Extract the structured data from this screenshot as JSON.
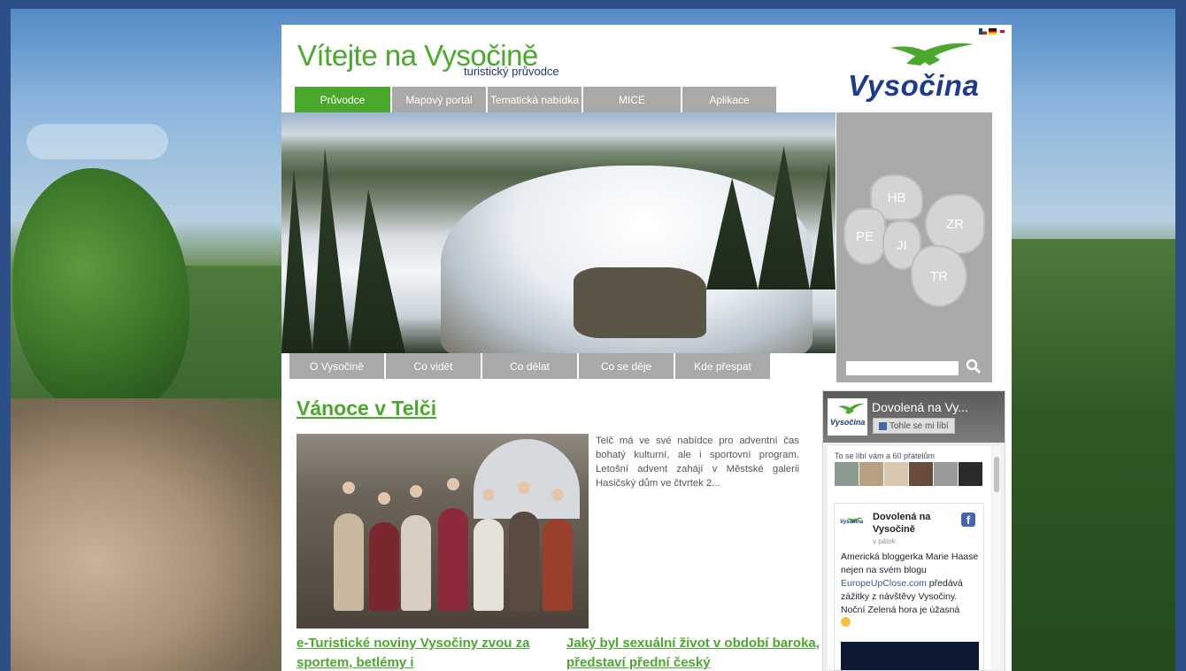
{
  "header": {
    "title": "Vítejte na Vysočině",
    "subtitle": "turistický průvodce",
    "logo_text": "Vysočina"
  },
  "top_nav": [
    {
      "label": "Průvodce"
    },
    {
      "label": "Mapový portál"
    },
    {
      "label": "Tematická nabídka"
    },
    {
      "label": "MICE"
    },
    {
      "label": "Aplikace"
    }
  ],
  "map_regions": {
    "hb": "HB",
    "pe": "PE",
    "ji": "JI",
    "zr": "ZR",
    "tr": "TR"
  },
  "search": {
    "value": "",
    "placeholder": ""
  },
  "sub_nav": [
    {
      "label": "O Vysočině"
    },
    {
      "label": "Co vidět"
    },
    {
      "label": "Co dělat"
    },
    {
      "label": "Co se děje"
    },
    {
      "label": "Kde přespat"
    }
  ],
  "article": {
    "title": "Vánoce v Telči",
    "text": "Telč má ve své nabídce pro adventní čas bohatý kulturní, ale i sportovní program. Letošní advent zahájí v Městské galerii Hasičský dům ve čtvrtek 2..."
  },
  "news": [
    {
      "title": "e-Turistické noviny Vysočiny zvou za sportem, betlémy i"
    },
    {
      "title": "Jaký byl sexuální život v období baroka, představí přední český"
    }
  ],
  "facebook": {
    "page_name": "Dovolená na Vy...",
    "like_label": "Tohle se mi líbí",
    "friends_text": "To se líbí vám a 60 přátelům",
    "post_author": "Dovolená na Vysočině",
    "post_time": "v pátek",
    "post_text_1": "Americká bloggerka Marie Haase nejen na svém blogu ",
    "post_link": "EuropeUpClose.com",
    "post_text_2": " předává zážitky z návštěvy Vysočiny. Noční Zelená hora je úžasná",
    "logo_text": "Vysočina"
  },
  "colors": {
    "accent_green": "#4aa82d",
    "nav_gray": "#a9a9a9",
    "brand_blue": "#1b3a90",
    "frame_blue": "#2c4f87"
  }
}
